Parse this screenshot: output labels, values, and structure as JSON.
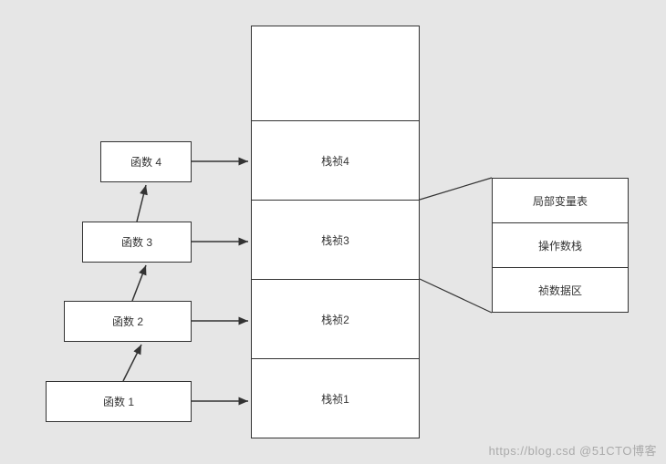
{
  "functions": {
    "f1": "函数 1",
    "f2": "函数 2",
    "f3": "函数 3",
    "f4": "函数 4"
  },
  "stack": {
    "empty": "",
    "s4": "栈祯4",
    "s3": "栈祯3",
    "s2": "栈祯2",
    "s1": "栈祯1"
  },
  "detail": {
    "localVars": "局部变量表",
    "operand": "操作数栈",
    "frameData": "祯数据区"
  },
  "watermark": "https://blog.csd @51CTO博客"
}
